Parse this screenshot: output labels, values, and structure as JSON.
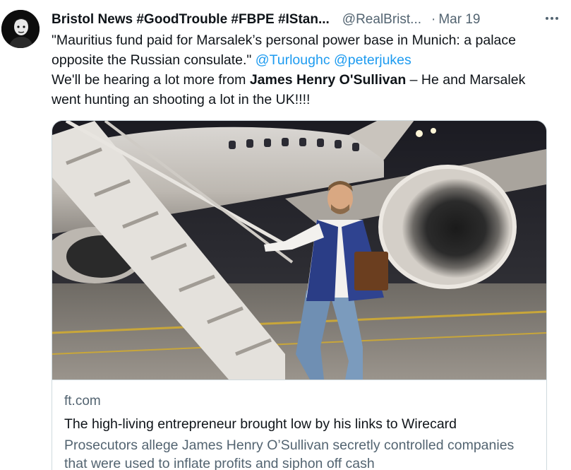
{
  "tweet": {
    "display_name": "Bristol News #GoodTrouble #FBPE #IStan...",
    "handle": "@RealBrist...",
    "separator": "·",
    "date": "Mar 19",
    "text": {
      "quote": "\"Mauritius fund paid for Marsalek’s personal power base in Munich: a palace opposite the Russian consulate.\"",
      "mention_1": "@Turloughc",
      "mention_2": "@peterjukes",
      "line_2_prefix": "We'll be hearing a lot more from",
      "bold_name": "James Henry O'Sullivan",
      "line_2_suffix": " – He and Marsalek went hunting an shooting a lot in the UK!!!!"
    }
  },
  "link_card": {
    "domain": "ft.com",
    "title": "The high-living entrepreneur brought low by his links to Wirecard",
    "description": "Prosecutors allege James Henry O’Sullivan secretly controlled companies that were used to inflate profits and siphon off cash"
  },
  "icons": {
    "more": "more-horizontal-icon",
    "avatar": "profile-avatar"
  },
  "colors": {
    "text_primary": "#0f1419",
    "text_secondary": "#536471",
    "link": "#1d9bf0",
    "border": "#cfd9de"
  }
}
